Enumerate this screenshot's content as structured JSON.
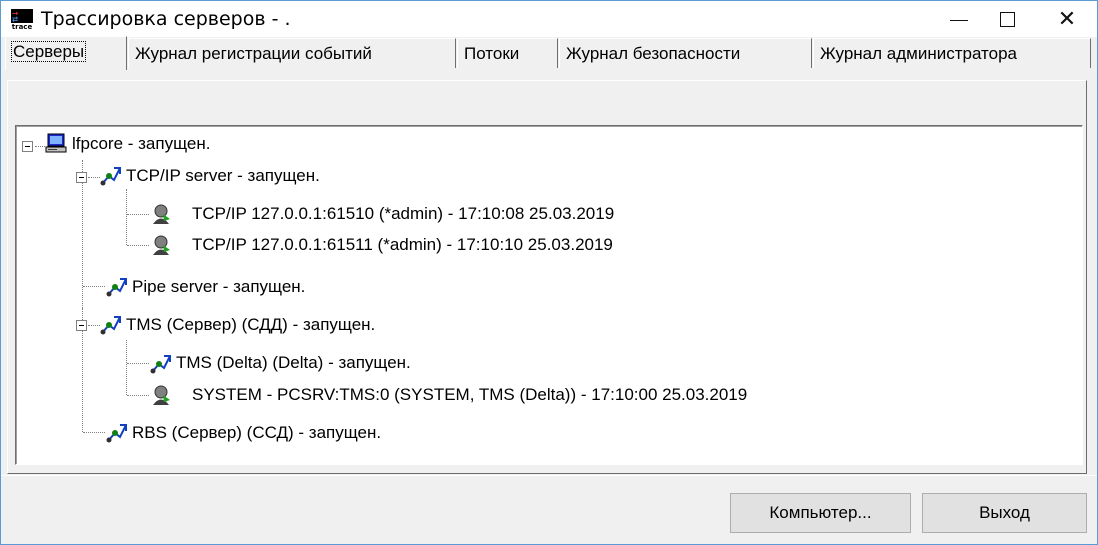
{
  "window": {
    "title": "Трассировка серверов - .",
    "icon": "trace-app-icon",
    "icon_label": "trace"
  },
  "tabs": [
    {
      "label": "Серверы",
      "active": true
    },
    {
      "label": "Журнал регистрации событий",
      "active": false
    },
    {
      "label": "Потоки",
      "active": false
    },
    {
      "label": "Журнал безопасности",
      "active": false
    },
    {
      "label": "Журнал администратора",
      "active": false
    }
  ],
  "tree": {
    "root": "lfpcore  - запущен.",
    "tcp_server": "TCP/IP server  - запущен.",
    "tcp_conn_1": "TCP/IP 127.0.0.1:61510 (*admin) - 17:10:08  25.03.2019",
    "tcp_conn_2": "TCP/IP 127.0.0.1:61511 (*admin) - 17:10:10  25.03.2019",
    "pipe_server": "Pipe server  - запущен.",
    "tms_server": "TMS (Сервер) (СДД)  - запущен.",
    "tms_delta": "TMS (Delta) (Delta)  - запущен.",
    "tms_system": "SYSTEM - PCSRV:TMS:0 (SYSTEM, TMS (Delta)) - 17:10:00  25.03.2019",
    "rbs_server": "RBS (Сервер) (ССД)  - запущен."
  },
  "buttons": {
    "computer": "Компьютер...",
    "exit": "Выход"
  }
}
